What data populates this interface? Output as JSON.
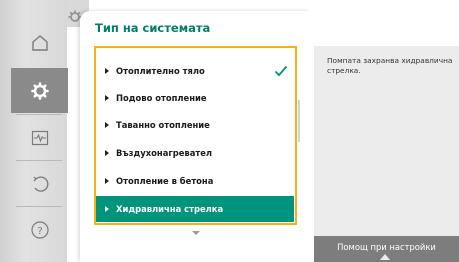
{
  "window": {
    "title": "Тип на системата"
  },
  "sidebar": {
    "items": [
      {
        "icon": "home-icon",
        "active": false
      },
      {
        "icon": "settings-icon",
        "active": true
      },
      {
        "icon": "diagnostics-icon",
        "active": false
      },
      {
        "icon": "restore-icon",
        "active": false
      },
      {
        "icon": "help-icon",
        "active": false
      }
    ]
  },
  "list": {
    "items": [
      {
        "label": "Отоплително тяло",
        "checked": true,
        "selected": false
      },
      {
        "label": "Подово отопление",
        "checked": false,
        "selected": false
      },
      {
        "label": "Таванно отопление",
        "checked": false,
        "selected": false
      },
      {
        "label": "Въздухонагревател",
        "checked": false,
        "selected": false
      },
      {
        "label": "Отопление в бетона",
        "checked": false,
        "selected": false
      },
      {
        "label": "Хидравлична стрелка",
        "checked": false,
        "selected": true
      }
    ]
  },
  "help": {
    "text": "Помпата захранва хидравлична стрелка.",
    "button_label": "Помощ при настройки"
  },
  "colors": {
    "accent": "#00947c",
    "title": "#007e6b",
    "focus_frame": "#f5b11a"
  }
}
